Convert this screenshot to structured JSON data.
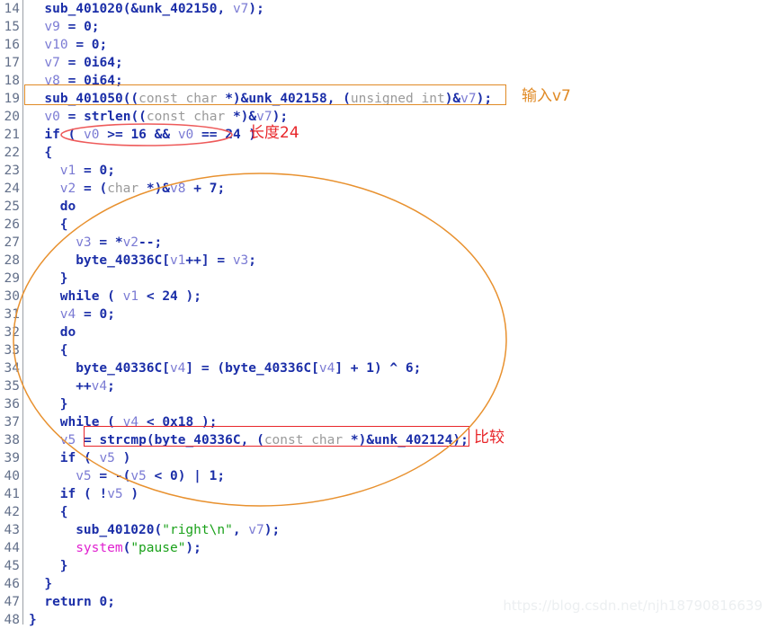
{
  "editor": {
    "kind": "decompiler-pseudocode-view",
    "background": "#ffffff",
    "gutter_text_color": "#63708a",
    "first_line_number": 14,
    "last_line_number": 48,
    "line_height_px": 20,
    "lines": [
      {
        "num": "14",
        "indent": 2,
        "segs": [
          {
            "t": "sub_401020",
            "c": "fn"
          },
          {
            "t": "(&",
            "c": "plain"
          },
          {
            "t": "unk_402150",
            "c": "fn"
          },
          {
            "t": ", ",
            "c": "plain"
          },
          {
            "t": "v7",
            "c": "var"
          },
          {
            "t": ");",
            "c": "plain"
          }
        ]
      },
      {
        "num": "15",
        "indent": 2,
        "segs": [
          {
            "t": "v9",
            "c": "var"
          },
          {
            "t": " = ",
            "c": "plain"
          },
          {
            "t": "0",
            "c": "num"
          },
          {
            "t": ";",
            "c": "plain"
          }
        ]
      },
      {
        "num": "16",
        "indent": 2,
        "segs": [
          {
            "t": "v10",
            "c": "var"
          },
          {
            "t": " = ",
            "c": "plain"
          },
          {
            "t": "0",
            "c": "num"
          },
          {
            "t": ";",
            "c": "plain"
          }
        ]
      },
      {
        "num": "17",
        "indent": 2,
        "segs": [
          {
            "t": "v7",
            "c": "var"
          },
          {
            "t": " = ",
            "c": "plain"
          },
          {
            "t": "0i64",
            "c": "num"
          },
          {
            "t": ";",
            "c": "plain"
          }
        ]
      },
      {
        "num": "18",
        "indent": 2,
        "segs": [
          {
            "t": "v8",
            "c": "var"
          },
          {
            "t": " = ",
            "c": "plain"
          },
          {
            "t": "0i64",
            "c": "num"
          },
          {
            "t": ";",
            "c": "plain"
          }
        ]
      },
      {
        "num": "19",
        "indent": 2,
        "segs": [
          {
            "t": "sub_401050",
            "c": "fn"
          },
          {
            "t": "((",
            "c": "plain"
          },
          {
            "t": "const char ",
            "c": "cast"
          },
          {
            "t": "*)&",
            "c": "plain"
          },
          {
            "t": "unk_402158",
            "c": "fn"
          },
          {
            "t": ", (",
            "c": "plain"
          },
          {
            "t": "unsigned int",
            "c": "cast"
          },
          {
            "t": ")&",
            "c": "plain"
          },
          {
            "t": "v7",
            "c": "var"
          },
          {
            "t": ");",
            "c": "plain"
          }
        ]
      },
      {
        "num": "20",
        "indent": 2,
        "segs": [
          {
            "t": "v0",
            "c": "var"
          },
          {
            "t": " = ",
            "c": "plain"
          },
          {
            "t": "strlen",
            "c": "fn"
          },
          {
            "t": "((",
            "c": "plain"
          },
          {
            "t": "const char ",
            "c": "cast"
          },
          {
            "t": "*)&",
            "c": "plain"
          },
          {
            "t": "v7",
            "c": "var"
          },
          {
            "t": ");",
            "c": "plain"
          }
        ]
      },
      {
        "num": "21",
        "indent": 2,
        "segs": [
          {
            "t": "if ( ",
            "c": "kw"
          },
          {
            "t": "v0",
            "c": "var"
          },
          {
            "t": " >= ",
            "c": "plain"
          },
          {
            "t": "16",
            "c": "num"
          },
          {
            "t": " && ",
            "c": "plain"
          },
          {
            "t": "v0",
            "c": "var"
          },
          {
            "t": " == ",
            "c": "plain"
          },
          {
            "t": "24",
            "c": "num"
          },
          {
            "t": " )",
            "c": "plain"
          }
        ]
      },
      {
        "num": "22",
        "indent": 2,
        "segs": [
          {
            "t": "{",
            "c": "plain"
          }
        ]
      },
      {
        "num": "23",
        "indent": 4,
        "segs": [
          {
            "t": "v1",
            "c": "var"
          },
          {
            "t": " = ",
            "c": "plain"
          },
          {
            "t": "0",
            "c": "num"
          },
          {
            "t": ";",
            "c": "plain"
          }
        ]
      },
      {
        "num": "24",
        "indent": 4,
        "segs": [
          {
            "t": "v2",
            "c": "var"
          },
          {
            "t": " = (",
            "c": "plain"
          },
          {
            "t": "char ",
            "c": "cast"
          },
          {
            "t": "*)&",
            "c": "plain"
          },
          {
            "t": "v8",
            "c": "var"
          },
          {
            "t": " + ",
            "c": "plain"
          },
          {
            "t": "7",
            "c": "num"
          },
          {
            "t": ";",
            "c": "plain"
          }
        ]
      },
      {
        "num": "25",
        "indent": 4,
        "segs": [
          {
            "t": "do",
            "c": "kw"
          }
        ]
      },
      {
        "num": "26",
        "indent": 4,
        "segs": [
          {
            "t": "{",
            "c": "plain"
          }
        ]
      },
      {
        "num": "27",
        "indent": 6,
        "segs": [
          {
            "t": "v3",
            "c": "var"
          },
          {
            "t": " = *",
            "c": "plain"
          },
          {
            "t": "v2",
            "c": "var"
          },
          {
            "t": "--;",
            "c": "plain"
          }
        ]
      },
      {
        "num": "28",
        "indent": 6,
        "segs": [
          {
            "t": "byte_40336C",
            "c": "fn"
          },
          {
            "t": "[",
            "c": "plain"
          },
          {
            "t": "v1",
            "c": "var"
          },
          {
            "t": "++] = ",
            "c": "plain"
          },
          {
            "t": "v3",
            "c": "var"
          },
          {
            "t": ";",
            "c": "plain"
          }
        ]
      },
      {
        "num": "29",
        "indent": 4,
        "segs": [
          {
            "t": "}",
            "c": "plain"
          }
        ]
      },
      {
        "num": "30",
        "indent": 4,
        "segs": [
          {
            "t": "while ( ",
            "c": "kw"
          },
          {
            "t": "v1",
            "c": "var"
          },
          {
            "t": " < ",
            "c": "plain"
          },
          {
            "t": "24",
            "c": "num"
          },
          {
            "t": " );",
            "c": "plain"
          }
        ]
      },
      {
        "num": "31",
        "indent": 4,
        "segs": [
          {
            "t": "v4",
            "c": "var"
          },
          {
            "t": " = ",
            "c": "plain"
          },
          {
            "t": "0",
            "c": "num"
          },
          {
            "t": ";",
            "c": "plain"
          }
        ]
      },
      {
        "num": "32",
        "indent": 4,
        "segs": [
          {
            "t": "do",
            "c": "kw"
          }
        ]
      },
      {
        "num": "33",
        "indent": 4,
        "segs": [
          {
            "t": "{",
            "c": "plain"
          }
        ]
      },
      {
        "num": "34",
        "indent": 6,
        "segs": [
          {
            "t": "byte_40336C",
            "c": "fn"
          },
          {
            "t": "[",
            "c": "plain"
          },
          {
            "t": "v4",
            "c": "var"
          },
          {
            "t": "] = (",
            "c": "plain"
          },
          {
            "t": "byte_40336C",
            "c": "fn"
          },
          {
            "t": "[",
            "c": "plain"
          },
          {
            "t": "v4",
            "c": "var"
          },
          {
            "t": "] + ",
            "c": "plain"
          },
          {
            "t": "1",
            "c": "num"
          },
          {
            "t": ") ^ ",
            "c": "plain"
          },
          {
            "t": "6",
            "c": "num"
          },
          {
            "t": ";",
            "c": "plain"
          }
        ]
      },
      {
        "num": "35",
        "indent": 6,
        "segs": [
          {
            "t": "++",
            "c": "plain"
          },
          {
            "t": "v4",
            "c": "var"
          },
          {
            "t": ";",
            "c": "plain"
          }
        ]
      },
      {
        "num": "36",
        "indent": 4,
        "segs": [
          {
            "t": "}",
            "c": "plain"
          }
        ]
      },
      {
        "num": "37",
        "indent": 4,
        "segs": [
          {
            "t": "while ( ",
            "c": "kw"
          },
          {
            "t": "v4",
            "c": "var"
          },
          {
            "t": " < ",
            "c": "plain"
          },
          {
            "t": "0x18",
            "c": "num"
          },
          {
            "t": " );",
            "c": "plain"
          }
        ]
      },
      {
        "num": "38",
        "indent": 4,
        "segs": [
          {
            "t": "v5",
            "c": "var"
          },
          {
            "t": " = ",
            "c": "plain"
          },
          {
            "t": "strcmp",
            "c": "fn"
          },
          {
            "t": "(",
            "c": "plain"
          },
          {
            "t": "byte_40336C",
            "c": "fn"
          },
          {
            "t": ", (",
            "c": "plain"
          },
          {
            "t": "const char ",
            "c": "cast"
          },
          {
            "t": "*)&",
            "c": "plain"
          },
          {
            "t": "unk_402124",
            "c": "fn"
          },
          {
            "t": ");",
            "c": "plain"
          }
        ]
      },
      {
        "num": "39",
        "indent": 4,
        "segs": [
          {
            "t": "if ( ",
            "c": "kw"
          },
          {
            "t": "v5",
            "c": "var"
          },
          {
            "t": " )",
            "c": "plain"
          }
        ]
      },
      {
        "num": "40",
        "indent": 6,
        "segs": [
          {
            "t": "v5",
            "c": "var"
          },
          {
            "t": " = -(",
            "c": "plain"
          },
          {
            "t": "v5",
            "c": "var"
          },
          {
            "t": " < ",
            "c": "plain"
          },
          {
            "t": "0",
            "c": "num"
          },
          {
            "t": ") | ",
            "c": "plain"
          },
          {
            "t": "1",
            "c": "num"
          },
          {
            "t": ";",
            "c": "plain"
          }
        ]
      },
      {
        "num": "41",
        "indent": 4,
        "segs": [
          {
            "t": "if ( !",
            "c": "kw"
          },
          {
            "t": "v5",
            "c": "var"
          },
          {
            "t": " )",
            "c": "plain"
          }
        ]
      },
      {
        "num": "42",
        "indent": 4,
        "segs": [
          {
            "t": "{",
            "c": "plain"
          }
        ]
      },
      {
        "num": "43",
        "indent": 6,
        "segs": [
          {
            "t": "sub_401020",
            "c": "fn"
          },
          {
            "t": "(",
            "c": "plain"
          },
          {
            "t": "\"right\\n\"",
            "c": "str"
          },
          {
            "t": ", ",
            "c": "plain"
          },
          {
            "t": "v7",
            "c": "var"
          },
          {
            "t": ");",
            "c": "plain"
          }
        ]
      },
      {
        "num": "44",
        "indent": 6,
        "segs": [
          {
            "t": "system",
            "c": "sys"
          },
          {
            "t": "(",
            "c": "plain"
          },
          {
            "t": "\"pause\"",
            "c": "str"
          },
          {
            "t": ");",
            "c": "plain"
          }
        ]
      },
      {
        "num": "45",
        "indent": 4,
        "segs": [
          {
            "t": "}",
            "c": "plain"
          }
        ]
      },
      {
        "num": "46",
        "indent": 2,
        "segs": [
          {
            "t": "}",
            "c": "plain"
          }
        ]
      },
      {
        "num": "47",
        "indent": 2,
        "segs": [
          {
            "t": "return ",
            "c": "kw"
          },
          {
            "t": "0",
            "c": "num"
          },
          {
            "t": ";",
            "c": "plain"
          }
        ]
      },
      {
        "num": "48",
        "indent": 0,
        "segs": [
          {
            "t": "}",
            "c": "plain"
          }
        ]
      }
    ]
  },
  "annotations": {
    "orange_color": "#e08a25",
    "red_color": "#e8262a",
    "input_label": {
      "text": "输入v7",
      "color": "#e08a25"
    },
    "length_label": {
      "text": "长度24",
      "color": "#e8262a"
    },
    "compare_label": {
      "text": "比较",
      "color": "#e8262a"
    },
    "box_call_line": {
      "target": "sub_401050 call",
      "color": "#e08a25"
    },
    "box_strcmp_line": {
      "target": "strcmp call",
      "color": "#e8262a"
    },
    "ellipse_condition": {
      "target": "v0 >= 16 && v0 == 24",
      "color": "#e8262a"
    },
    "ellipse_loops": {
      "target": "both do-while transform loops",
      "color": "#e08a25"
    }
  },
  "watermark": {
    "text": "https://blog.csdn.net/njh18790816639",
    "color": "#eceff1"
  }
}
